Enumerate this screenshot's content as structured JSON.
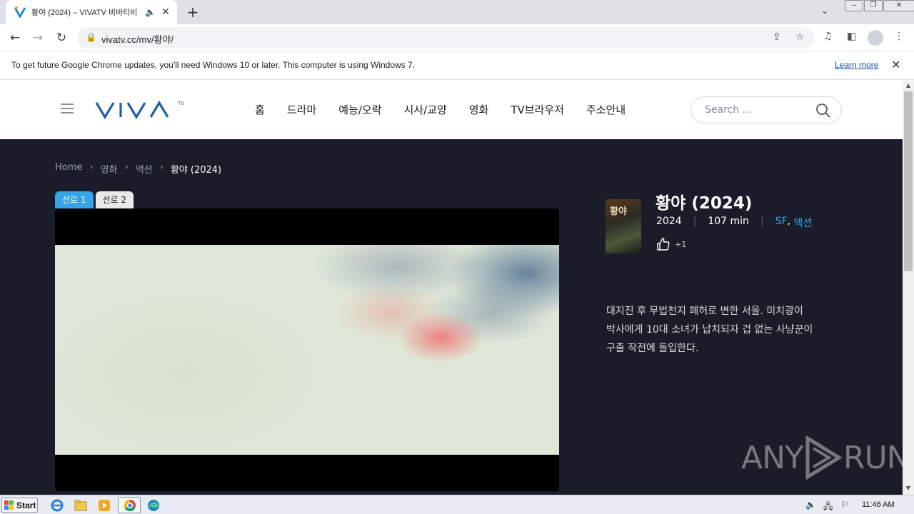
{
  "browser": {
    "tab_title": "황야 (2024) – VIVATV 비바티비",
    "tab_audio_icon": "speaker-icon",
    "url": "vivatv.cc/mv/황야/",
    "infobar_text": "To get future Google Chrome updates, you'll need Windows 10 or later. This computer is using Windows 7.",
    "infobar_link": "Learn more"
  },
  "site": {
    "logo_text": "VIVA",
    "logo_sup": "TV",
    "nav": [
      "홈",
      "드라마",
      "예능/오락",
      "시사/교양",
      "영화",
      "TV브라우저",
      "주소안내"
    ],
    "search_placeholder": "Search ..."
  },
  "breadcrumb": [
    "Home",
    "영화",
    "액션",
    "황야 (2024)"
  ],
  "player": {
    "server_tabs": [
      "선로 1",
      "선로 2"
    ],
    "active_tab": 0
  },
  "movie": {
    "poster_text": "황야",
    "title": "황야 (2024)",
    "year": "2024",
    "runtime": "107 min",
    "genres": [
      "SF",
      "액션"
    ],
    "likes": "+1",
    "synopsis": "대지진 후 무법천지 폐허로 변한 서울. 미치광이 박사에게 10대 소녀가 납치되자 겁 없는 사냥꾼이 구출 작전에 돌입한다."
  },
  "watermark": {
    "left": "ANY",
    "right": "RUN"
  },
  "taskbar": {
    "start_label": "Start",
    "clock": "11:46 AM"
  },
  "colors": {
    "accent": "#38a3e8",
    "dark_bg": "#1a1d29",
    "logo_blue": "#1f5fa8"
  }
}
